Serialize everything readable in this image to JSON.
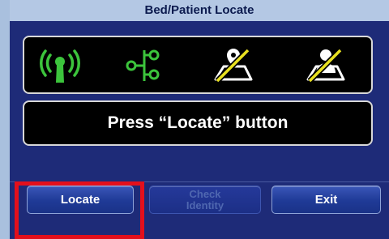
{
  "window": {
    "title": "Bed/Patient Locate"
  },
  "status_icons": [
    {
      "name": "wireless-signal-icon",
      "color": "#3cc43c"
    },
    {
      "name": "network-connection-icon",
      "color": "#3cc43c"
    },
    {
      "name": "bed-location-disabled-icon",
      "color": "#ffffff",
      "slash_color": "#e8e020"
    },
    {
      "name": "patient-identity-disabled-icon",
      "color": "#ffffff",
      "slash_color": "#e8e020"
    }
  ],
  "message": "Press “Locate” button",
  "buttons": {
    "locate": "Locate",
    "check_identity_line1": "Check",
    "check_identity_line2": "Identity",
    "exit": "Exit"
  },
  "colors": {
    "panel_bg": "#1e2b78",
    "title_bg": "#b4c8e4",
    "highlight": "#e3101c"
  }
}
